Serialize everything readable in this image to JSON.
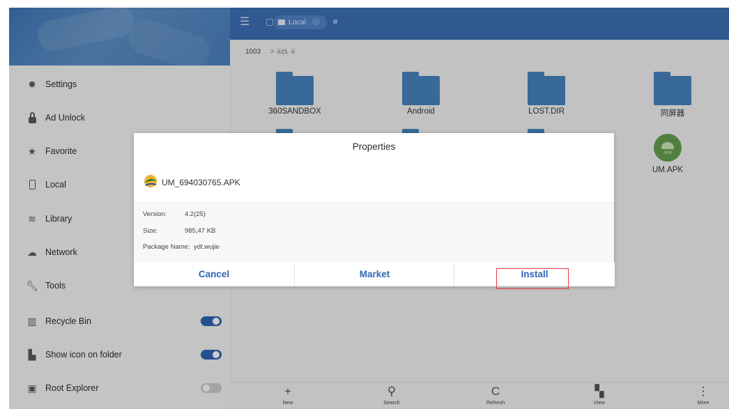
{
  "topbar": {
    "location_chip": "Local"
  },
  "path": {
    "root": "1003",
    "separator": ">",
    "current": "ɨɨȥȽ ɨɨ"
  },
  "sidebar": {
    "items": [
      {
        "label": "Settings",
        "icon": "gear-icon"
      },
      {
        "label": "Ad Unlock",
        "icon": "lock-icon"
      },
      {
        "label": "Favorite",
        "icon": "star-icon"
      },
      {
        "label": "Local",
        "icon": "phone-icon"
      },
      {
        "label": "Library",
        "icon": "layers-icon"
      },
      {
        "label": "Network",
        "icon": "network-icon"
      },
      {
        "label": "Tools",
        "icon": "wrench-icon"
      },
      {
        "label": "Recycle Bin",
        "icon": "trash-icon",
        "toggle": true
      },
      {
        "label": "Show icon on folder",
        "icon": "folder-image-icon",
        "toggle": true
      },
      {
        "label": "Root Explorer",
        "icon": "root-icon",
        "toggle": false
      }
    ]
  },
  "files": [
    {
      "name": "360SANDBOX",
      "type": "folder"
    },
    {
      "name": "Android",
      "type": "folder"
    },
    {
      "name": "LOST.DIR",
      "type": "folder"
    },
    {
      "name": "同屏器",
      "type": "folder"
    },
    {
      "name": "UM.APK",
      "type": "apk",
      "badge": "APK"
    }
  ],
  "bottom_bar": {
    "new": "New",
    "search": "Search",
    "refresh": "Refresh",
    "view": "View",
    "more": "More"
  },
  "dialog": {
    "title": "Properties",
    "file_name": "UM_694030765.APK",
    "version_label": "Version:",
    "version_value": "4.2(25)",
    "size_label": "Size:",
    "size_value": "985,47 KB",
    "package_label": "Package Name:",
    "package_value": "ydt.wujie",
    "cancel_label": "Cancel",
    "market_label": "Market",
    "install_label": "Install"
  },
  "colors": {
    "primary": "#3d6fb6",
    "button_text": "#2f66b5",
    "highlight": "#e23a3a",
    "folder": "#4784bf",
    "apk": "#689f4e"
  }
}
